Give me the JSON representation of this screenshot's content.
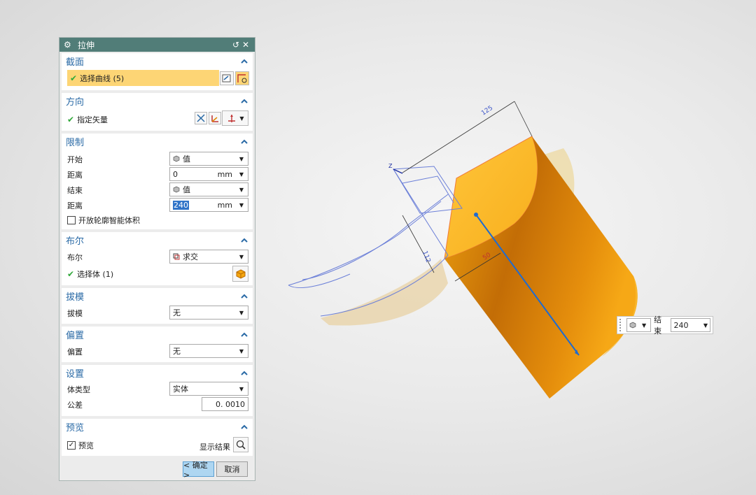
{
  "dialog": {
    "title": "拉伸",
    "icons": {
      "gear": "gear-icon",
      "reset": "reset-icon",
      "close": "close-icon"
    }
  },
  "sections": {
    "section": {
      "title": "截面",
      "select_curve": "选择曲线 (5)"
    },
    "direction": {
      "title": "方向",
      "specify_vector": "指定矢量"
    },
    "limits": {
      "title": "限制",
      "start_label": "开始",
      "start_value": "值",
      "start_distance_label": "距离",
      "start_distance": "0",
      "start_unit": "mm",
      "end_label": "结束",
      "end_value": "值",
      "end_distance_label": "距离",
      "end_distance": "240",
      "end_unit": "mm",
      "open_profile_label": "开放轮廓智能体积"
    },
    "boolean": {
      "title": "布尔",
      "boolean_label": "布尔",
      "boolean_value": "求交",
      "select_body": "选择体 (1)"
    },
    "draft": {
      "title": "拔模",
      "draft_label": "拔模",
      "draft_value": "无"
    },
    "offset": {
      "title": "偏置",
      "offset_label": "偏置",
      "offset_value": "无"
    },
    "settings": {
      "title": "设置",
      "body_type_label": "体类型",
      "body_type_value": "实体",
      "tolerance_label": "公差",
      "tolerance_value": "0. 0010"
    },
    "preview": {
      "title": "预览",
      "preview_label": "预览",
      "preview_checked": true,
      "show_result_label": "显示结果"
    }
  },
  "buttons": {
    "ok": "< 确定 >",
    "cancel": "取消"
  },
  "floating_input": {
    "label": "结束",
    "value": "240"
  },
  "viewport": {
    "dimension_labels": [
      "125",
      "112",
      "50"
    ],
    "model_color": "#f5a60f",
    "preview_color": "#e8d2a4",
    "vector_color": "#1f6bd0"
  }
}
